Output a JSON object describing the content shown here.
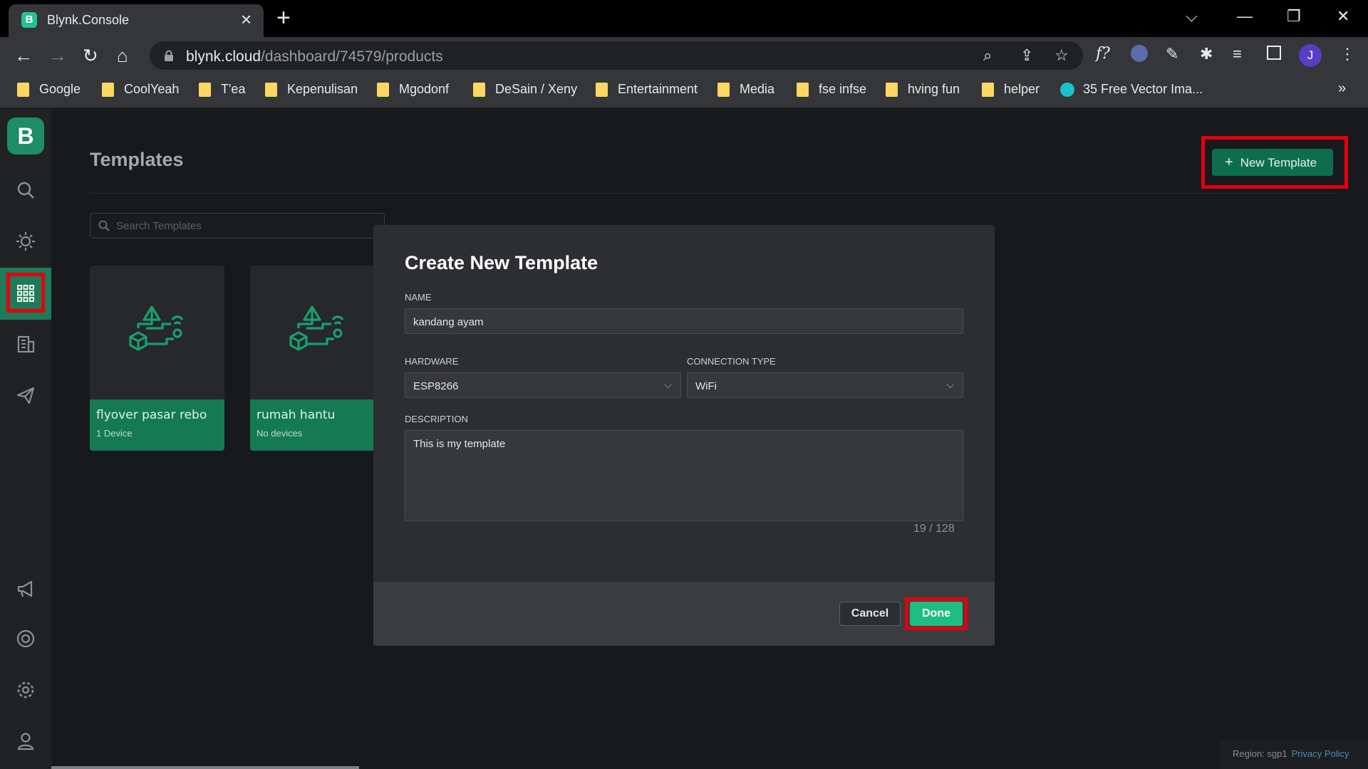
{
  "browser": {
    "tab_title": "Blynk.Console",
    "tab_favicon": "B",
    "url_host": "blynk.cloud",
    "url_path": "/dashboard/74579/products",
    "profile_initial": "J",
    "bookmarks": [
      "Google",
      "CoolYeah",
      "T'ea",
      "Kepenulisan",
      "Mgodonf",
      "DeSain / Xeny",
      "Entertainment",
      "Media",
      "fse infse",
      "hving fun",
      "helper",
      "35 Free Vector Ima..."
    ],
    "bookmarks_more": "»",
    "extension_label": "f?"
  },
  "sidebar": {
    "logo": "B",
    "items": [
      "search-icon",
      "sun-icon",
      "grid-icon",
      "building-icon",
      "send-icon",
      "megaphone-icon",
      "lifebuoy-icon",
      "gear-icon",
      "user-icon"
    ],
    "active_item": "grid-icon"
  },
  "page": {
    "title": "Templates",
    "new_template_label": "New Template",
    "search_placeholder": "Search Templates"
  },
  "templates": [
    {
      "name": "flyover pasar rebo",
      "devices": "1 Device"
    },
    {
      "name": "rumah hantu",
      "devices": "No devices"
    }
  ],
  "modal": {
    "title": "Create New Template",
    "name_label": "NAME",
    "name_value": "kandang ayam",
    "hardware_label": "HARDWARE",
    "hardware_value": "ESP8266",
    "connection_label": "CONNECTION TYPE",
    "connection_value": "WiFi",
    "description_label": "DESCRIPTION",
    "description_value": "This is my template",
    "counter": "19 / 128",
    "cancel_label": "Cancel",
    "done_label": "Done"
  },
  "footer": {
    "region": "Region: sgp1",
    "privacy": "Privacy Policy"
  },
  "colors": {
    "accent": "#1ebd81",
    "brand_dark": "#157a54",
    "highlight": "#e3000f"
  }
}
